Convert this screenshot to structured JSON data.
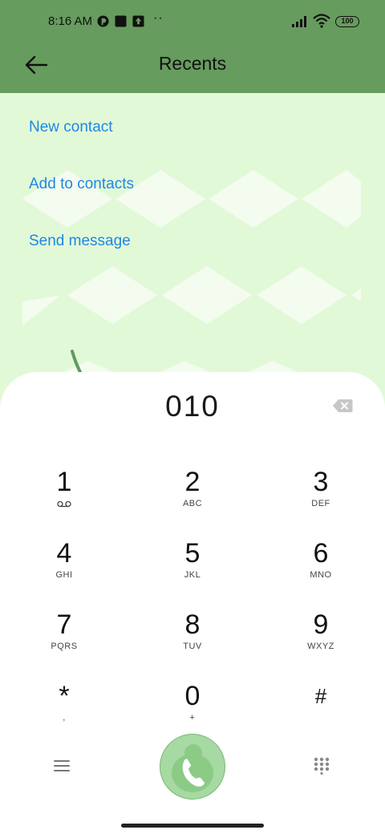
{
  "status_bar": {
    "time": "8:16 AM",
    "more_indicator": "··",
    "battery": "100"
  },
  "header": {
    "title": "Recents",
    "back_icon": "arrow-left-icon"
  },
  "actions": {
    "new_contact": "New contact",
    "add_to_contacts": "Add to contacts",
    "send_message": "Send message"
  },
  "dialer": {
    "number": "010",
    "keys": [
      {
        "digit": "1",
        "letters": "",
        "icon": "voicemail-icon"
      },
      {
        "digit": "2",
        "letters": "ABC"
      },
      {
        "digit": "3",
        "letters": "DEF"
      },
      {
        "digit": "4",
        "letters": "GHI"
      },
      {
        "digit": "5",
        "letters": "JKL"
      },
      {
        "digit": "6",
        "letters": "MNO"
      },
      {
        "digit": "7",
        "letters": "PQRS"
      },
      {
        "digit": "8",
        "letters": "TUV"
      },
      {
        "digit": "9",
        "letters": "WXYZ"
      },
      {
        "digit": "*",
        "letters": ","
      },
      {
        "digit": "0",
        "letters": "+"
      },
      {
        "digit": "#",
        "letters": ""
      }
    ]
  },
  "colors": {
    "header": "#669c5d",
    "background": "#e2f9d8",
    "link": "#1e88e5",
    "call_button": "#a7d9a2"
  }
}
